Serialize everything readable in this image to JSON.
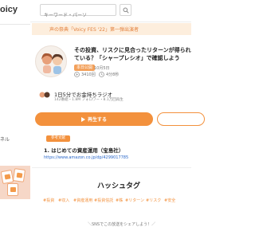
{
  "sidebar": {
    "logo_text": "oicy",
    "side_text": "ネル"
  },
  "search": {
    "placeholder": "キーワード・パーソ"
  },
  "banner": {
    "text": "声の祭典「Voicy FES '22」第一弾出演者"
  },
  "episode": {
    "title": "その投資、リスクに見合ったリターンが得られている？「シャープレシオ」で確認しよう",
    "badge": "本日公開",
    "date": "10月5日",
    "play_count": "3410回",
    "duration": "4分8秒"
  },
  "channel": {
    "name": "1日5分でお金持ちラジオ",
    "meta": "142番組・1.8M フォロワー・8.1万回再生"
  },
  "actions": {
    "play_label": "再生する"
  },
  "description": {
    "tag": "参考文献",
    "line": "1. はじめての資産運用（宝島社）",
    "link": "https://www.amazon.co.jp/dp/4299017785"
  },
  "hashtags": {
    "heading": "ハッシュタグ",
    "items": [
      "#投資",
      "#収入",
      "#資産運用",
      "#投資信託",
      "#株",
      "#リターン",
      "#リスク",
      "#安全"
    ]
  },
  "share": {
    "text": "＼SNSでこの放送をシェアしよう！／"
  },
  "colors": {
    "accent": "#f3913d",
    "banner_bg": "#fdeedd",
    "link": "#2a67c9"
  }
}
